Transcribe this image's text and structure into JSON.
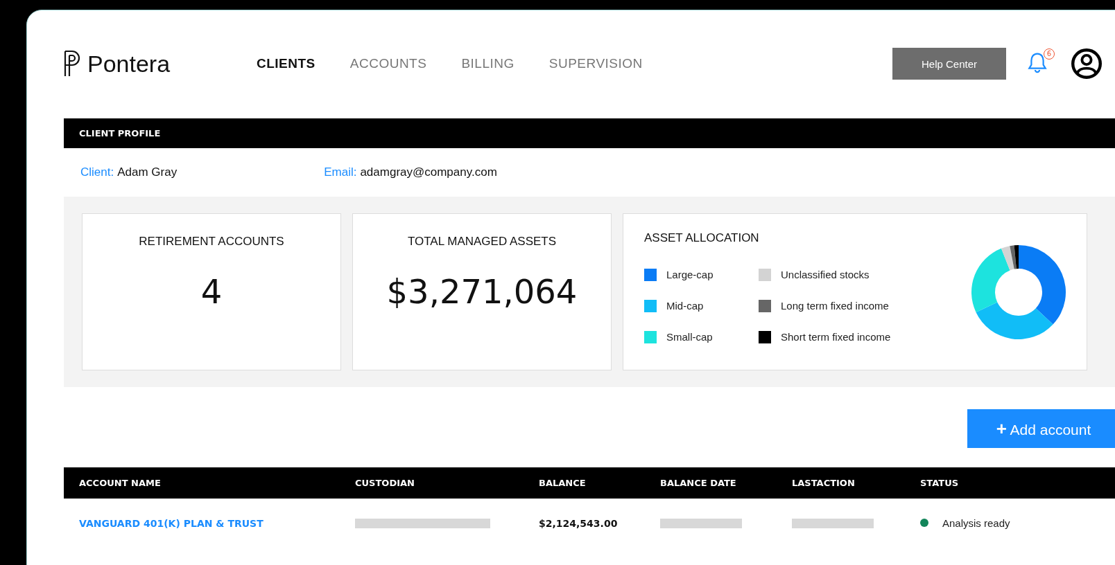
{
  "logo": {
    "name": "Pontera"
  },
  "nav": [
    {
      "label": "CLIENTS",
      "selected": true
    },
    {
      "label": "ACCOUNTS",
      "selected": false
    },
    {
      "label": "BILLING",
      "selected": false
    },
    {
      "label": "SUPERVISION",
      "selected": false
    }
  ],
  "help_button": "Help Center",
  "notifications": {
    "count": "6"
  },
  "client_profile": {
    "title": "CLIENT PROFILE",
    "client_label": "Client:",
    "client": "Adam Gray",
    "email_label": "Email:",
    "email": "adamgray@company.com"
  },
  "stats": [
    {
      "title": "RETIREMENT ACCOUNTS",
      "value": "4"
    },
    {
      "title": "TOTAL MANAGED ASSETS",
      "value": "$3,271,064"
    }
  ],
  "asset_allocation": {
    "title": "ASSET ALLOCATION",
    "legend": [
      {
        "label": "Large-cap",
        "color": "#0a7cf5"
      },
      {
        "label": "Mid-cap",
        "color": "#11bdf7"
      },
      {
        "label": "Small-cap",
        "color": "#1de3de"
      },
      {
        "label": "Unclassified stocks",
        "color": "#d3d3d3"
      },
      {
        "label": "Long term fixed income",
        "color": "#666666"
      },
      {
        "label": "Short term fixed income",
        "color": "#000000"
      }
    ]
  },
  "add_button": {
    "icon": "+",
    "label": "Add account"
  },
  "table": {
    "columns": [
      "ACCOUNT NAME",
      "CUSTODIAN",
      "BALANCE",
      "BALANCE DATE",
      "LASTACTION",
      "STATUS"
    ],
    "rows": [
      {
        "account_name": "VANGUARD 401(K) PLAN & TRUST",
        "balance": "$2,124,543.00",
        "status": "Analysis ready",
        "color": "#12855a"
      }
    ]
  }
}
